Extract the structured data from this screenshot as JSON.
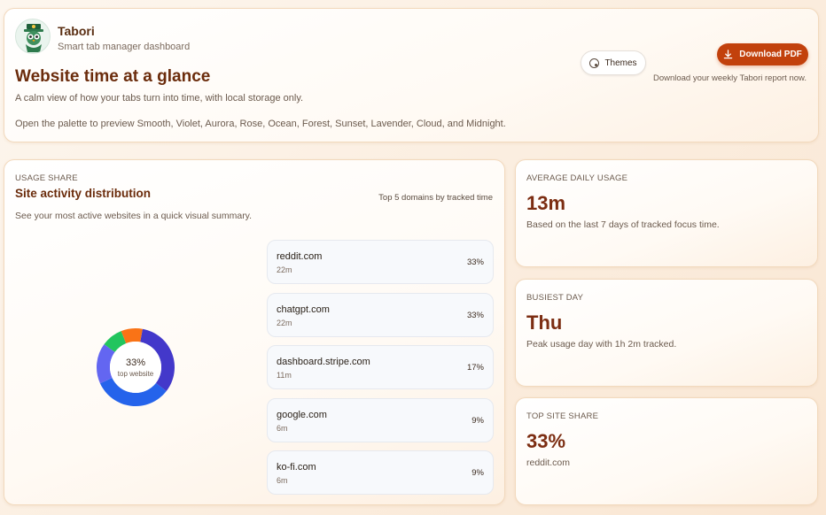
{
  "brand": {
    "name": "Tabori",
    "subtitle": "Smart tab manager dashboard"
  },
  "header": {
    "title": "Website time at a glance",
    "description": "A calm view of how your tabs turn into time, with local storage only.",
    "palette_note": "Open the palette to preview Smooth, Violet, Aurora, Rose, Ocean, Forest, Sunset, Lavender, Cloud, and Midnight.",
    "themes_label": "Themes",
    "download_label": "Download PDF",
    "download_note": "Download your weekly Tabori report now."
  },
  "usage": {
    "eyebrow": "USAGE SHARE",
    "title": "Site activity distribution",
    "top_note": "Top 5 domains by tracked time",
    "description": "See your most active websites in a quick visual summary.",
    "donut_pct": "33%",
    "donut_label": "top website",
    "domains": [
      {
        "name": "reddit.com",
        "time": "22m",
        "pct": "33%",
        "share": 33,
        "color": "#4338ca"
      },
      {
        "name": "chatgpt.com",
        "time": "22m",
        "pct": "33%",
        "share": 33,
        "color": "#2563eb"
      },
      {
        "name": "dashboard.stripe.com",
        "time": "11m",
        "pct": "17%",
        "share": 17,
        "color": "#6366f1"
      },
      {
        "name": "google.com",
        "time": "6m",
        "pct": "9%",
        "share": 9,
        "color": "#22c55e"
      },
      {
        "name": "ko-fi.com",
        "time": "6m",
        "pct": "9%",
        "share": 9,
        "color": "#f97316"
      }
    ]
  },
  "stats": {
    "average": {
      "label": "AVERAGE DAILY USAGE",
      "value": "13m",
      "desc": "Based on the last 7 days of tracked focus time."
    },
    "busiest": {
      "label": "BUSIEST DAY",
      "value": "Thu",
      "desc": "Peak usage day with 1h 2m tracked."
    },
    "top_site": {
      "label": "TOP SITE SHARE",
      "value": "33%",
      "desc": "reddit.com"
    }
  },
  "colors": {
    "accent": "#c2410c",
    "title": "#6b2c0c"
  }
}
